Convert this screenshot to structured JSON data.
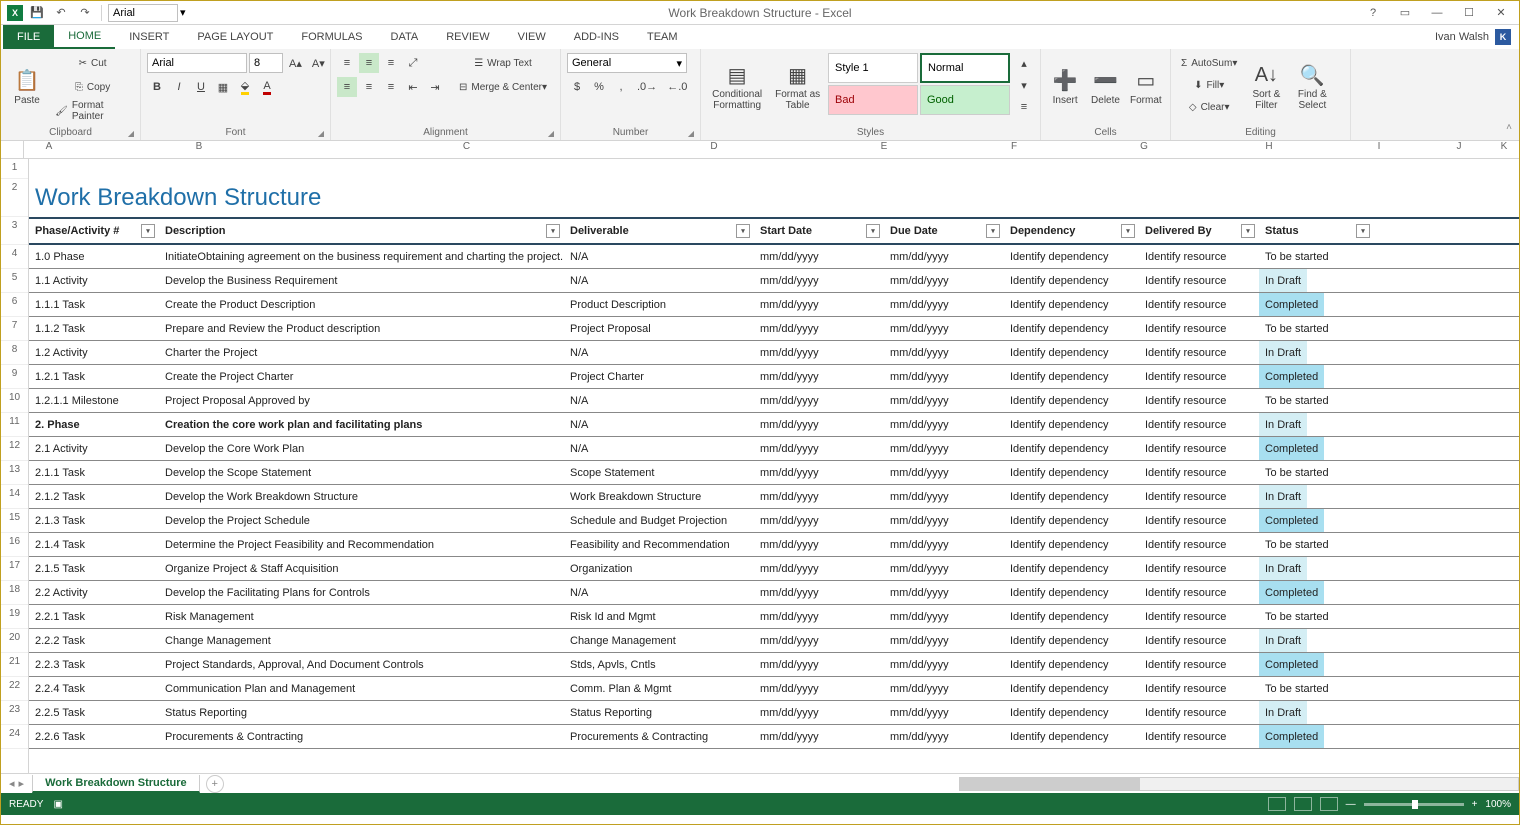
{
  "app": {
    "title": "Work Breakdown Structure - Excel",
    "user": "Ivan Walsh",
    "user_initial": "K",
    "qat_font": "Arial"
  },
  "tabs": {
    "file": "FILE",
    "list": [
      "HOME",
      "INSERT",
      "PAGE LAYOUT",
      "FORMULAS",
      "DATA",
      "REVIEW",
      "VIEW",
      "ADD-INS",
      "TEAM"
    ],
    "active": "HOME"
  },
  "ribbon": {
    "clipboard": {
      "label": "Clipboard",
      "paste": "Paste",
      "cut": "Cut",
      "copy": "Copy",
      "painter": "Format Painter"
    },
    "font": {
      "label": "Font",
      "name": "Arial",
      "size": "8"
    },
    "alignment": {
      "label": "Alignment",
      "wrap": "Wrap Text",
      "merge": "Merge & Center"
    },
    "number": {
      "label": "Number",
      "format": "General"
    },
    "styles": {
      "label": "Styles",
      "cond": "Conditional Formatting",
      "table": "Format as Table",
      "style1": "Style 1",
      "normal": "Normal",
      "bad": "Bad",
      "good": "Good"
    },
    "cells": {
      "label": "Cells",
      "insert": "Insert",
      "delete": "Delete",
      "format": "Format"
    },
    "editing": {
      "label": "Editing",
      "autosum": "AutoSum",
      "fill": "Fill",
      "clear": "Clear",
      "sort": "Sort & Filter",
      "find": "Find & Select"
    }
  },
  "columns_letters": [
    "A",
    "B",
    "C",
    "D",
    "E",
    "F",
    "G",
    "H",
    "I",
    "J",
    "K"
  ],
  "sheet_title": "Work Breakdown Structure",
  "headers": [
    "Phase/Activity #",
    "Description",
    "Deliverable",
    "Start Date",
    "Due Date",
    "Dependency",
    "Delivered By",
    "Status"
  ],
  "rows": [
    {
      "num": "4",
      "bold": false,
      "cells": [
        "1.0 Phase",
        "InitiateObtaining agreement on the business requirement and charting the project.",
        "N/A",
        "mm/dd/yyyy",
        "mm/dd/yyyy",
        "Identify dependency",
        "Identify resource",
        "To be started"
      ],
      "status": "started"
    },
    {
      "num": "5",
      "bold": false,
      "cells": [
        "1.1 Activity",
        "Develop the Business Requirement",
        "N/A",
        "mm/dd/yyyy",
        "mm/dd/yyyy",
        "Identify dependency",
        "Identify resource",
        "In Draft"
      ],
      "status": "draft"
    },
    {
      "num": "6",
      "bold": false,
      "cells": [
        "1.1.1 Task",
        "Create the Product Description",
        "Product Description",
        "mm/dd/yyyy",
        "mm/dd/yyyy",
        "Identify dependency",
        "Identify resource",
        "Completed"
      ],
      "status": "completed"
    },
    {
      "num": "7",
      "bold": false,
      "cells": [
        "1.1.2 Task",
        "Prepare and Review  the Product description",
        "Project Proposal",
        "mm/dd/yyyy",
        "mm/dd/yyyy",
        "Identify dependency",
        "Identify resource",
        "To be started"
      ],
      "status": "started"
    },
    {
      "num": "8",
      "bold": false,
      "cells": [
        "1.2 Activity",
        "Charter the Project",
        "N/A",
        "mm/dd/yyyy",
        "mm/dd/yyyy",
        "Identify dependency",
        "Identify resource",
        "In Draft"
      ],
      "status": "draft"
    },
    {
      "num": "9",
      "bold": false,
      "cells": [
        "1.2.1 Task",
        "Create the Project Charter",
        "Project Charter",
        "mm/dd/yyyy",
        "mm/dd/yyyy",
        "Identify dependency",
        "Identify resource",
        "Completed"
      ],
      "status": "completed"
    },
    {
      "num": "10",
      "bold": false,
      "cells": [
        "1.2.1.1 Milestone",
        "Project Proposal Approved by",
        "N/A",
        "mm/dd/yyyy",
        "mm/dd/yyyy",
        "Identify dependency",
        "Identify resource",
        "To be started"
      ],
      "status": "started"
    },
    {
      "num": "11",
      "bold": true,
      "cells": [
        "2. Phase",
        "Creation the core work plan and facilitating plans",
        "N/A",
        "mm/dd/yyyy",
        "mm/dd/yyyy",
        "Identify dependency",
        "Identify resource",
        "In Draft"
      ],
      "status": "draft"
    },
    {
      "num": "12",
      "bold": false,
      "cells": [
        "2.1 Activity",
        "Develop the Core Work Plan",
        "N/A",
        "mm/dd/yyyy",
        "mm/dd/yyyy",
        "Identify dependency",
        "Identify resource",
        "Completed"
      ],
      "status": "completed"
    },
    {
      "num": "13",
      "bold": false,
      "cells": [
        "2.1.1 Task",
        "Develop the Scope Statement",
        "Scope Statement",
        "mm/dd/yyyy",
        "mm/dd/yyyy",
        "Identify dependency",
        "Identify resource",
        "To be started"
      ],
      "status": "started"
    },
    {
      "num": "14",
      "bold": false,
      "cells": [
        "2.1.2 Task",
        "Develop the Work Breakdown Structure",
        "Work Breakdown Structure",
        "mm/dd/yyyy",
        "mm/dd/yyyy",
        "Identify dependency",
        "Identify resource",
        "In Draft"
      ],
      "status": "draft"
    },
    {
      "num": "15",
      "bold": false,
      "cells": [
        "2.1.3 Task",
        "Develop the Project Schedule",
        "Schedule and Budget Projection",
        "mm/dd/yyyy",
        "mm/dd/yyyy",
        "Identify dependency",
        "Identify resource",
        "Completed"
      ],
      "status": "completed"
    },
    {
      "num": "16",
      "bold": false,
      "cells": [
        "2.1.4 Task",
        "Determine the Project Feasibility and Recommendation",
        "Feasibility and Recommendation",
        "mm/dd/yyyy",
        "mm/dd/yyyy",
        "Identify dependency",
        "Identify resource",
        "To be started"
      ],
      "status": "started"
    },
    {
      "num": "17",
      "bold": false,
      "cells": [
        "2.1.5 Task",
        "Organize Project & Staff Acquisition",
        "Organization",
        "mm/dd/yyyy",
        "mm/dd/yyyy",
        "Identify dependency",
        "Identify resource",
        "In Draft"
      ],
      "status": "draft"
    },
    {
      "num": "18",
      "bold": false,
      "cells": [
        "2.2 Activity",
        "Develop the Facilitating Plans for Controls",
        "N/A",
        "mm/dd/yyyy",
        "mm/dd/yyyy",
        "Identify dependency",
        "Identify resource",
        "Completed"
      ],
      "status": "completed"
    },
    {
      "num": "19",
      "bold": false,
      "cells": [
        "2.2.1 Task",
        "Risk Management",
        "Risk Id and Mgmt",
        "mm/dd/yyyy",
        "mm/dd/yyyy",
        "Identify dependency",
        "Identify resource",
        "To be started"
      ],
      "status": "started"
    },
    {
      "num": "20",
      "bold": false,
      "cells": [
        "2.2.2 Task",
        "Change Management",
        "Change Management",
        "mm/dd/yyyy",
        "mm/dd/yyyy",
        "Identify dependency",
        "Identify resource",
        "In Draft"
      ],
      "status": "draft"
    },
    {
      "num": "21",
      "bold": false,
      "cells": [
        "2.2.3 Task",
        "Project Standards, Approval, And Document Controls",
        "Stds, Apvls, Cntls",
        "mm/dd/yyyy",
        "mm/dd/yyyy",
        "Identify dependency",
        "Identify resource",
        "Completed"
      ],
      "status": "completed"
    },
    {
      "num": "22",
      "bold": false,
      "cells": [
        "2.2.4 Task",
        "Communication Plan and Management",
        "Comm. Plan & Mgmt",
        "mm/dd/yyyy",
        "mm/dd/yyyy",
        "Identify dependency",
        "Identify resource",
        "To be started"
      ],
      "status": "started"
    },
    {
      "num": "23",
      "bold": false,
      "cells": [
        "2.2.5 Task",
        "Status Reporting",
        "Status Reporting",
        "mm/dd/yyyy",
        "mm/dd/yyyy",
        "Identify dependency",
        "Identify resource",
        "In Draft"
      ],
      "status": "draft"
    },
    {
      "num": "24",
      "bold": false,
      "cells": [
        "2.2.6 Task",
        "Procurements & Contracting",
        "Procurements & Contracting",
        "mm/dd/yyyy",
        "mm/dd/yyyy",
        "Identify dependency",
        "Identify resource",
        "Completed"
      ],
      "status": "completed"
    }
  ],
  "sheet_tab": "Work Breakdown Structure",
  "statusbar": {
    "ready": "READY",
    "zoom": "100%"
  }
}
